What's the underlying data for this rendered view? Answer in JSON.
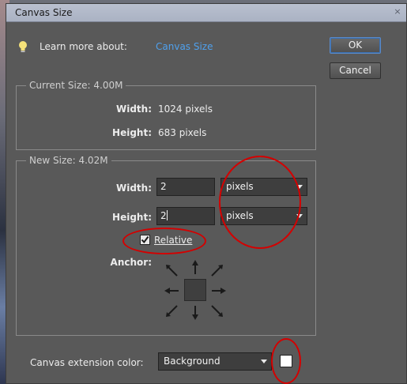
{
  "window": {
    "title": "Canvas Size",
    "close_glyph": "×"
  },
  "learn_more": {
    "label": "Learn more about:",
    "link": "Canvas Size",
    "icon": "lightbulb-icon"
  },
  "buttons": {
    "ok": "OK",
    "cancel": "Cancel"
  },
  "current_size": {
    "legend": "Current Size: 4.00M",
    "width_label": "Width:",
    "width_value": "1024 pixels",
    "height_label": "Height:",
    "height_value": "683 pixels"
  },
  "new_size": {
    "legend": "New Size: 4.02M",
    "width_label": "Width:",
    "width_value": "2",
    "width_unit": "pixels",
    "height_label": "Height:",
    "height_value": "2",
    "height_unit": "pixels",
    "relative_label": "Relative",
    "relative_checked": true,
    "anchor_label": "Anchor:"
  },
  "extension": {
    "label": "Canvas extension color:",
    "value": "Background",
    "swatch_color": "#ffffff"
  },
  "colors": {
    "accent_link": "#4fa0ec",
    "annotation": "#d40000",
    "dialog_bg": "#595959"
  }
}
